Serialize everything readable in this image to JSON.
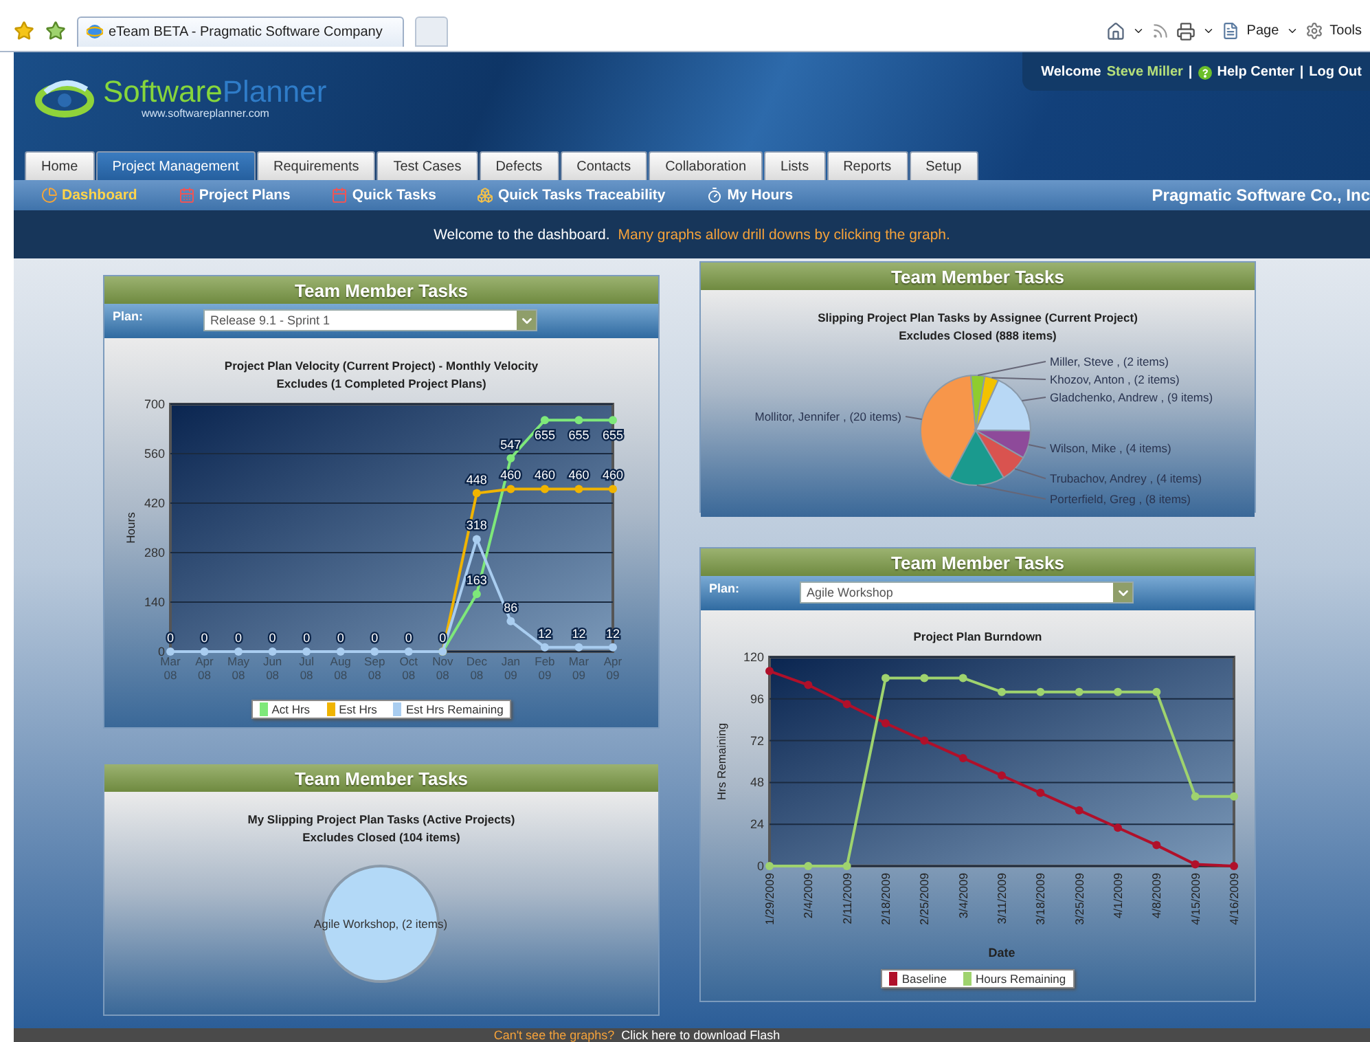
{
  "browser": {
    "tab_title": "eTeam BETA - Pragmatic Software Company",
    "toolbar": [
      "Page",
      "Tools"
    ]
  },
  "header": {
    "logo_words": [
      "Software",
      "Planner"
    ],
    "logo_url": "www.softwareplanner.com",
    "welcome": "Welcome",
    "user": "Steve Miller",
    "links": [
      "Help Center",
      "Log Out"
    ],
    "separators": [
      "|",
      "|"
    ]
  },
  "tabs": [
    {
      "label": "Home",
      "selected": false
    },
    {
      "label": "Project Management",
      "selected": true
    },
    {
      "label": "Requirements",
      "selected": false
    },
    {
      "label": "Test Cases",
      "selected": false
    },
    {
      "label": "Defects",
      "selected": false
    },
    {
      "label": "Contacts",
      "selected": false
    },
    {
      "label": "Collaboration",
      "selected": false
    },
    {
      "label": "Lists",
      "selected": false
    },
    {
      "label": "Reports",
      "selected": false
    },
    {
      "label": "Setup",
      "selected": false
    }
  ],
  "subnav": [
    {
      "label": "Dashboard",
      "selected": true
    },
    {
      "label": "Project Plans",
      "selected": false
    },
    {
      "label": "Quick Tasks",
      "selected": false
    },
    {
      "label": "Quick Tasks Traceability",
      "selected": false
    },
    {
      "label": "My Hours",
      "selected": false
    }
  ],
  "company": "Pragmatic Software Co., Inc",
  "welcome_bar": {
    "message": "Welcome to the dashboard.",
    "hint": "Many graphs allow drill downs by clicking the graph."
  },
  "velocity": {
    "heading": "Team Member Tasks",
    "plan_label": "Plan:",
    "plan_value": "Release 9.1 - Sprint 1",
    "subtitle": "Excludes (1 Completed Project Plans)",
    "chart_data": {
      "type": "line",
      "title": "Project Plan Velocity (Current Project) - Monthly Velocity",
      "ylabel": "Hours",
      "categories": [
        "Mar 08",
        "Apr 08",
        "May 08",
        "Jun 08",
        "Jul 08",
        "Aug 08",
        "Sep 08",
        "Oct 08",
        "Nov 08",
        "Dec 08",
        "Jan 09",
        "Feb 09",
        "Mar 09",
        "Apr 09"
      ],
      "ylim": [
        0,
        700
      ],
      "yticks": [
        0,
        140,
        280,
        420,
        560,
        700
      ],
      "grid": true,
      "value_labels": [
        [
          null,
          null,
          null,
          null,
          null,
          null,
          null,
          null,
          null,
          "163",
          "547",
          "655",
          "655",
          "655"
        ],
        [
          null,
          null,
          null,
          null,
          null,
          null,
          null,
          null,
          null,
          "448",
          "460",
          "460",
          "460",
          "460"
        ],
        [
          "0",
          "0",
          "0",
          "0",
          "0",
          "0",
          "0",
          "0",
          "0",
          "318",
          "86",
          "12",
          "12",
          "12"
        ]
      ],
      "series": [
        {
          "name": "Act Hrs",
          "color": "#7ee87a",
          "marker": "circle",
          "values": [
            null,
            null,
            null,
            null,
            null,
            null,
            null,
            null,
            0,
            163,
            547,
            655,
            655,
            655
          ]
        },
        {
          "name": "Est Hrs",
          "color": "#f0b400",
          "marker": "circle",
          "values": [
            null,
            null,
            null,
            null,
            null,
            null,
            null,
            null,
            0,
            448,
            460,
            460,
            460,
            460
          ]
        },
        {
          "name": "Est Hrs Remaining",
          "color": "#a9cdf0",
          "marker": "circle",
          "values": [
            0,
            0,
            0,
            0,
            0,
            0,
            0,
            0,
            0,
            318,
            86,
            12,
            12,
            12
          ]
        }
      ]
    }
  },
  "slipping": {
    "heading": "Team Member Tasks",
    "subtitle": "Excludes Closed (888 items)",
    "chart_data": {
      "type": "pie",
      "title": "Slipping Project Plan Tasks by Assignee (Current Project)",
      "categories": [
        "Miller, Steve , (2 items)",
        "Khozov, Anton , (2 items)",
        "Gladchenko, Andrew , (9 items)",
        "Wilson, Mike , (4 items)",
        "Trubachov, Andrey , (4 items)",
        "Porterfield, Greg , (8 items)",
        "Mollitor, Jennifer , (20 items)"
      ],
      "colors": [
        "#8fcc2e",
        "#f2c200",
        "#b8d8f5",
        "#8e4a9a",
        "#d9534f",
        "#1a9a8e",
        "#f7964a"
      ],
      "series": [
        {
          "values": [
            2,
            2,
            9,
            4,
            4,
            8,
            20
          ]
        }
      ]
    }
  },
  "burndown": {
    "heading": "Team Member Tasks",
    "plan_label": "Plan:",
    "plan_value": "Agile Workshop",
    "chart_data": {
      "type": "line",
      "title": "Project Plan Burndown",
      "xlabel": "Date",
      "ylabel": "Hrs Remaining",
      "categories": [
        "1/29/2009",
        "2/4/2009",
        "2/11/2009",
        "2/18/2009",
        "2/25/2009",
        "3/4/2009",
        "3/11/2009",
        "3/18/2009",
        "3/25/2009",
        "4/1/2009",
        "4/8/2009",
        "4/15/2009",
        "4/16/2009"
      ],
      "ylim": [
        0,
        120
      ],
      "yticks": [
        0,
        24,
        48,
        72,
        96,
        120
      ],
      "grid": true,
      "series": [
        {
          "name": "Baseline",
          "color": "#b0102a",
          "marker": "circle",
          "values": [
            112,
            104,
            93,
            82,
            72,
            62,
            52,
            42,
            32,
            22,
            12,
            1,
            0
          ]
        },
        {
          "name": "Hours Remaining",
          "color": "#9fd36e",
          "marker": "circle",
          "values": [
            0,
            0,
            0,
            108,
            108,
            108,
            100,
            100,
            100,
            100,
            100,
            40,
            40
          ]
        }
      ]
    }
  },
  "my_slipping": {
    "heading": "Team Member Tasks",
    "subtitle": "Excludes Closed (104 items)",
    "chart_data": {
      "type": "pie",
      "title": "My Slipping Project Plan Tasks (Active Projects)",
      "categories": [
        "Agile Workshop, (2 items)"
      ],
      "colors": [
        "#b3d9f7"
      ]
    }
  },
  "footer": {
    "warning": "Can't see the graphs?",
    "link": "Click here to download Flash"
  }
}
